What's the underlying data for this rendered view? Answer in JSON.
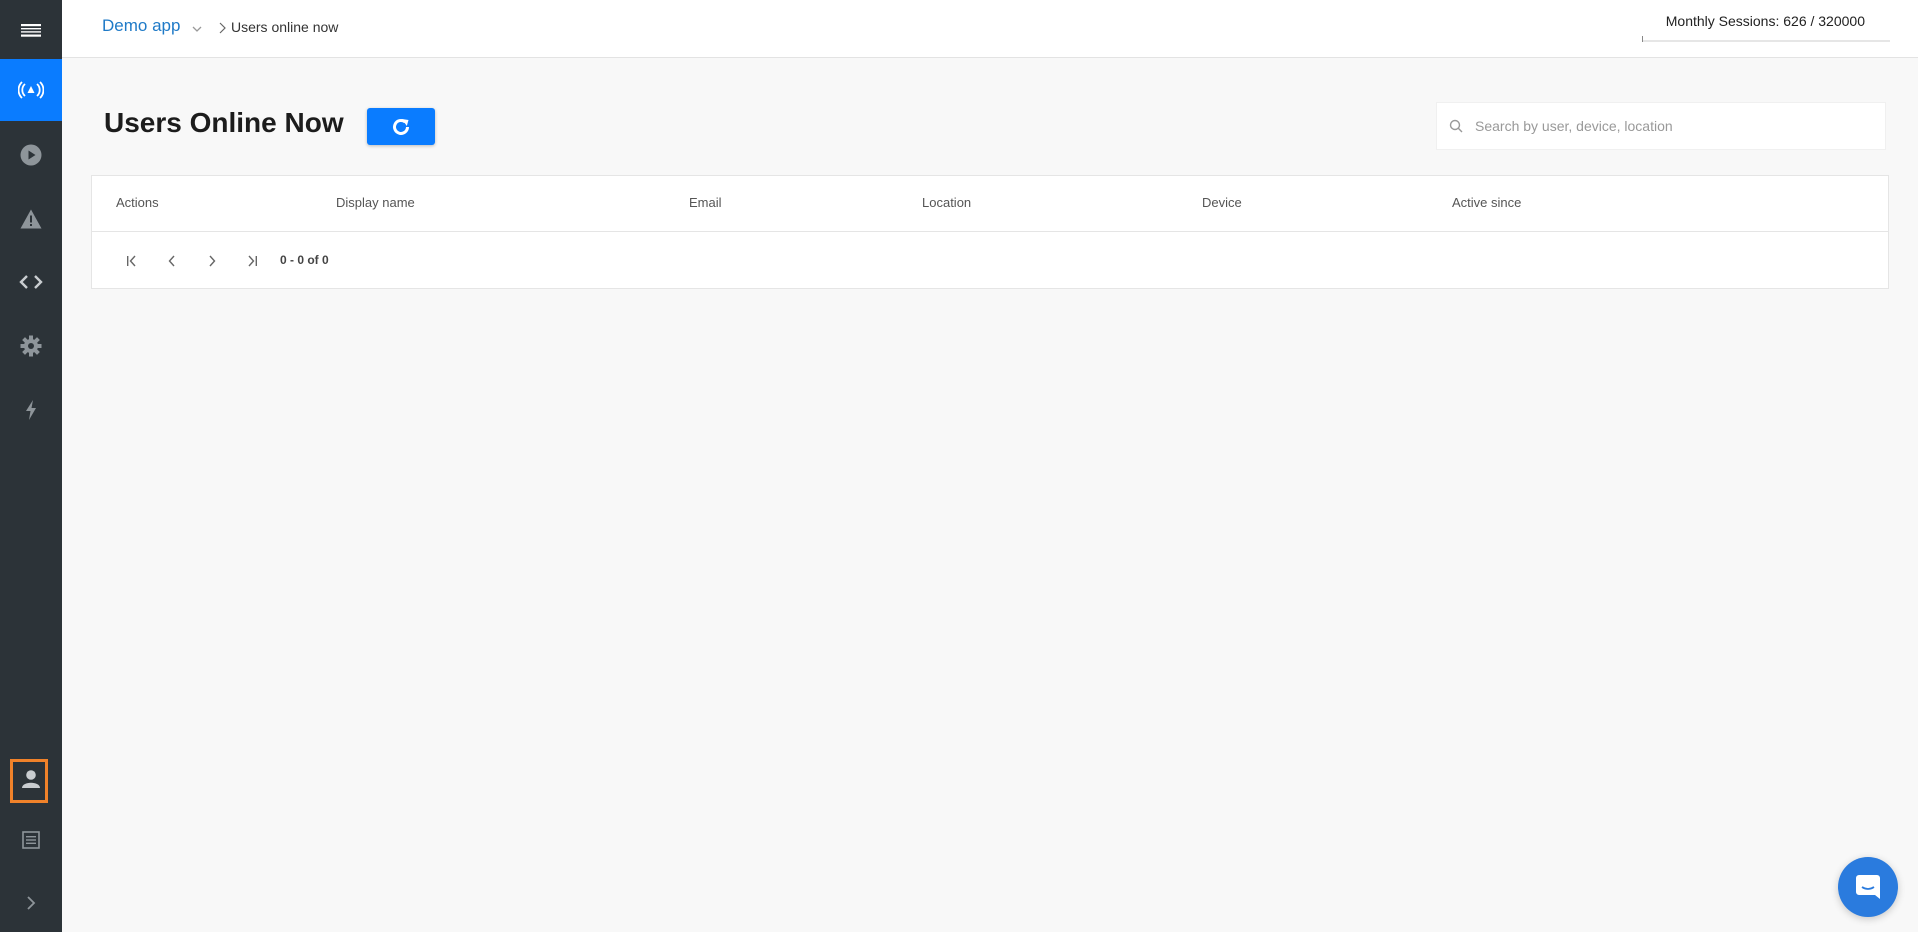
{
  "header": {
    "app_name": "Demo app",
    "breadcrumb_current": "Users online now",
    "monthly_sessions": "Monthly Sessions: 626 / 320000"
  },
  "sidebar": {
    "items": [
      {
        "icon": "menu-icon"
      },
      {
        "icon": "broadcast-icon",
        "active": true
      },
      {
        "icon": "play-circle-icon"
      },
      {
        "icon": "warning-icon"
      },
      {
        "icon": "code-icon"
      },
      {
        "icon": "gear-icon"
      },
      {
        "icon": "lightning-icon"
      },
      {
        "icon": "user-icon",
        "highlighted": true
      },
      {
        "icon": "document-icon"
      },
      {
        "icon": "chevron-right-icon"
      }
    ]
  },
  "page": {
    "title": "Users Online Now",
    "search_placeholder": "Search by user, device, location"
  },
  "table": {
    "columns": [
      "Actions",
      "Display name",
      "Email",
      "Location",
      "Device",
      "Active since"
    ],
    "rows": [],
    "pagination_range": "0 - 0 of 0"
  },
  "colors": {
    "sidebar_bg": "#2c3338",
    "accent": "#0a7cff",
    "highlight_frame": "#f0822a",
    "chat_button": "#2a7bde"
  }
}
